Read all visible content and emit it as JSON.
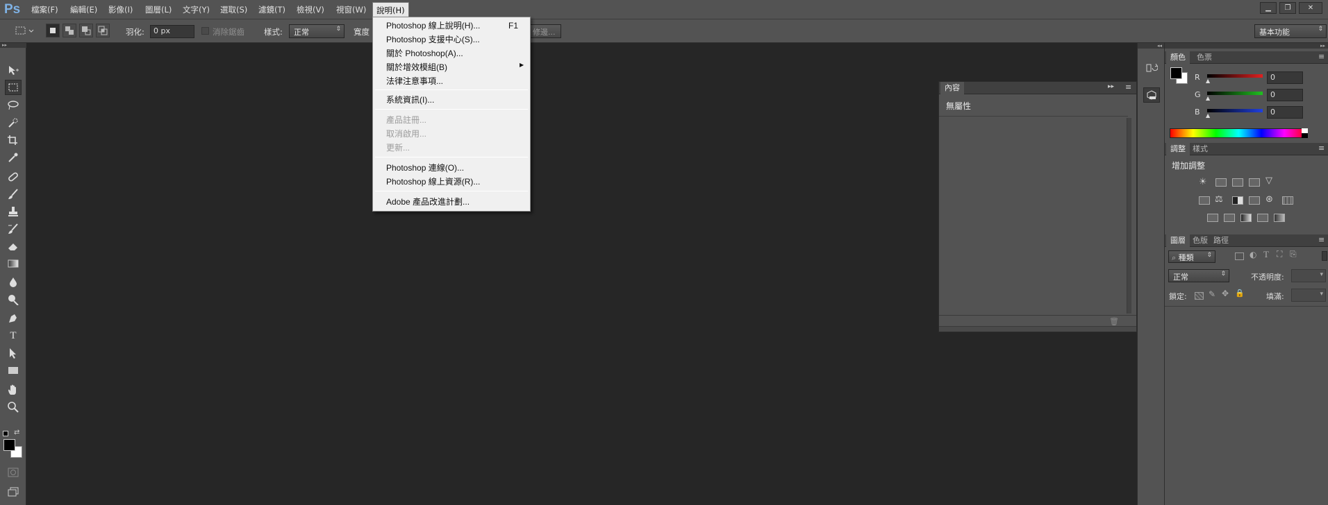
{
  "app": {
    "logo": "Ps"
  },
  "menubar": {
    "items": [
      "檔案(F)",
      "編輯(E)",
      "影像(I)",
      "圖層(L)",
      "文字(Y)",
      "選取(S)",
      "濾鏡(T)",
      "檢視(V)",
      "視窗(W)",
      "說明(H)"
    ],
    "window_controls": [
      "minimize",
      "restore",
      "close"
    ]
  },
  "options": {
    "feather_label": "羽化:",
    "feather_value": "0 px",
    "antialias_label": "消除鋸齒",
    "style_label": "樣式:",
    "style_value": "正常",
    "width_label": "寬度",
    "refine_label": "修邊...",
    "workspace": "基本功能"
  },
  "help_menu": {
    "items": [
      {
        "label": "Photoshop 線上說明(H)...",
        "shortcut": "F1",
        "enabled": true
      },
      {
        "label": "Photoshop 支援中心(S)...",
        "shortcut": "",
        "enabled": true
      },
      {
        "label": "關於 Photoshop(A)...",
        "shortcut": "",
        "enabled": true
      },
      {
        "label": "關於增效模組(B)",
        "shortcut": "",
        "enabled": true,
        "submenu": true
      },
      {
        "label": "法律注意事項...",
        "shortcut": "",
        "enabled": true
      },
      {
        "label": "系統資訊(I)...",
        "shortcut": "",
        "enabled": true
      },
      {
        "label": "產品註冊...",
        "shortcut": "",
        "enabled": false
      },
      {
        "label": "取消啟用...",
        "shortcut": "",
        "enabled": false
      },
      {
        "label": "更新...",
        "shortcut": "",
        "enabled": false
      },
      {
        "label": "Photoshop 連線(O)...",
        "shortcut": "",
        "enabled": true
      },
      {
        "label": "Photoshop 線上資源(R)...",
        "shortcut": "",
        "enabled": true
      },
      {
        "label": "Adobe 產品改進計劃...",
        "shortcut": "",
        "enabled": true
      }
    ]
  },
  "properties_panel": {
    "tab": "內容",
    "status": "無屬性"
  },
  "color_panel": {
    "tabs": [
      "顏色",
      "色票"
    ],
    "channels": [
      {
        "name": "R",
        "value": "0",
        "color": "#e02020"
      },
      {
        "name": "G",
        "value": "0",
        "color": "#20c020"
      },
      {
        "name": "B",
        "value": "0",
        "color": "#2040e0"
      }
    ],
    "foreground": "#000000",
    "background": "#ffffff"
  },
  "adjustments_panel": {
    "tabs": [
      "調整",
      "樣式"
    ],
    "title": "增加調整"
  },
  "layers_panel": {
    "tabs": [
      "圖層",
      "色版",
      "路徑"
    ],
    "filter_kind": "種類",
    "blend_mode": "正常",
    "opacity_label": "不透明度:",
    "lock_label": "鎖定:",
    "fill_label": "填滿:"
  },
  "colors": {
    "app_bg": "#262626",
    "chrome": "#535353",
    "menu_bg": "#f0f0f0",
    "logo": "#7fb2e5"
  }
}
